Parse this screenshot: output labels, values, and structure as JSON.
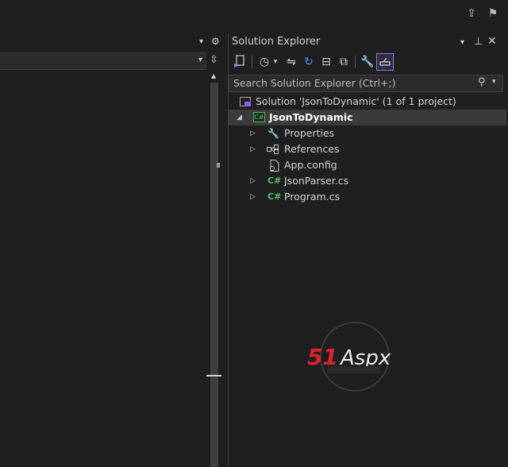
{
  "panel": {
    "title": "Solution Explorer",
    "search_placeholder": "Search Solution Explorer (Ctrl+;)"
  },
  "tree": {
    "solution": "Solution 'JsonToDynamic' (1 of 1 project)",
    "project": "JsonToDynamic",
    "items": [
      {
        "label": "Properties",
        "icon": "wrench-icon",
        "expandable": true
      },
      {
        "label": "References",
        "icon": "references-icon",
        "expandable": true
      },
      {
        "label": "App.config",
        "icon": "config-file-icon",
        "expandable": false
      },
      {
        "label": "JsonParser.cs",
        "icon": "csharp-file-icon",
        "expandable": true
      },
      {
        "label": "Program.cs",
        "icon": "csharp-file-icon",
        "expandable": true
      }
    ]
  },
  "icons": {
    "cs": "C#"
  },
  "watermark": {
    "brand_red": "51",
    "brand_green": "Aspx"
  },
  "colors": {
    "accent_purple": "#9b6cff",
    "cs_green": "#4ec66d",
    "logo_red": "#e0202a",
    "logo_green": "#39b54a"
  }
}
